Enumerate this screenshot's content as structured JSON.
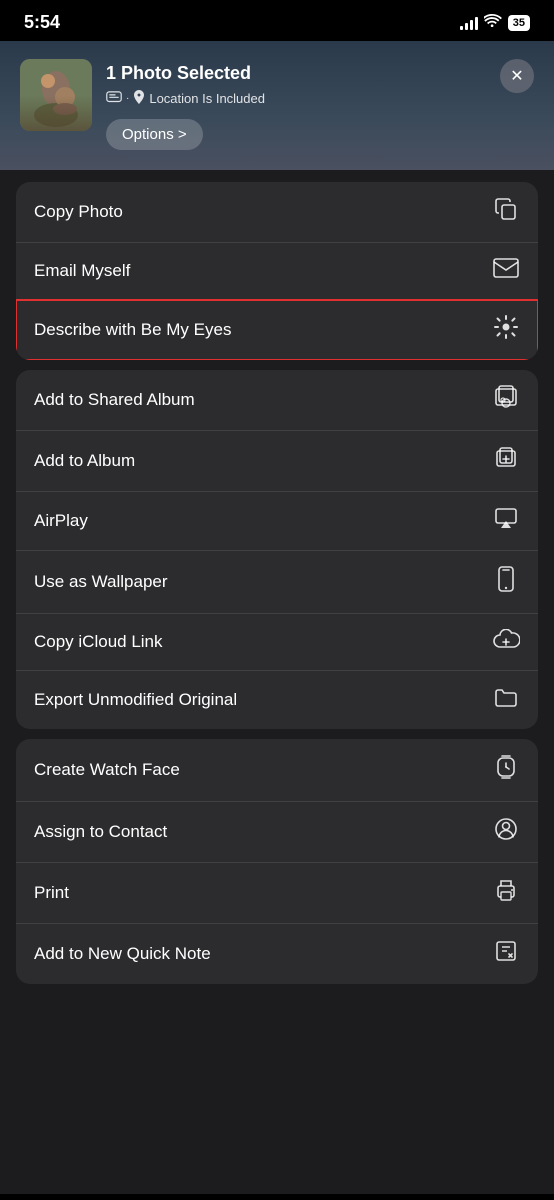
{
  "statusBar": {
    "time": "5:54",
    "battery": "35"
  },
  "shareHeader": {
    "photoAlt": "Photo of person with dog",
    "title": "1 Photo Selected",
    "subtitle": "Location Is Included",
    "optionsLabel": "Options >",
    "closeLabel": "✕"
  },
  "sections": [
    {
      "id": "section-1",
      "items": [
        {
          "id": "copy-photo",
          "label": "Copy Photo",
          "icon": "copy"
        },
        {
          "id": "email-myself",
          "label": "Email Myself",
          "icon": "email"
        },
        {
          "id": "describe-be-my-eyes",
          "label": "Describe with Be My Eyes",
          "icon": "sun",
          "highlighted": true
        }
      ]
    },
    {
      "id": "section-2",
      "items": [
        {
          "id": "add-shared-album",
          "label": "Add to Shared Album",
          "icon": "shared-album"
        },
        {
          "id": "add-album",
          "label": "Add to Album",
          "icon": "album"
        },
        {
          "id": "airplay",
          "label": "AirPlay",
          "icon": "airplay"
        },
        {
          "id": "use-wallpaper",
          "label": "Use as Wallpaper",
          "icon": "phone"
        },
        {
          "id": "copy-icloud",
          "label": "Copy iCloud Link",
          "icon": "cloud"
        },
        {
          "id": "export-original",
          "label": "Export Unmodified Original",
          "icon": "folder"
        }
      ]
    },
    {
      "id": "section-3",
      "items": [
        {
          "id": "create-watch-face",
          "label": "Create Watch Face",
          "icon": "watch"
        },
        {
          "id": "assign-contact",
          "label": "Assign to Contact",
          "icon": "person"
        },
        {
          "id": "print",
          "label": "Print",
          "icon": "print"
        },
        {
          "id": "add-quick-note",
          "label": "Add to New Quick Note",
          "icon": "note"
        }
      ]
    }
  ]
}
